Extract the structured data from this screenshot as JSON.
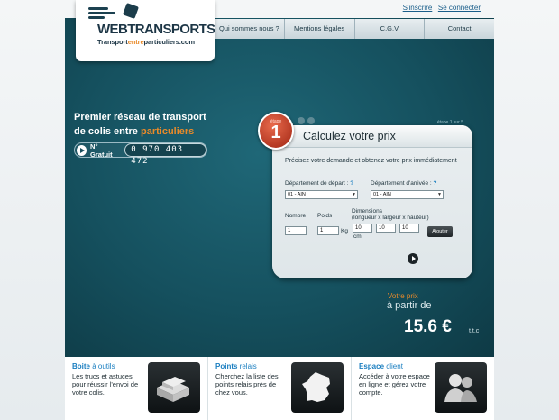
{
  "brand": {
    "logo_main": "WEBTRANSPORTS",
    "logo_sub_a": "Transport",
    "logo_sub_b": "entre",
    "logo_sub_c": "particuliers",
    "logo_sub_d": ".com"
  },
  "account_links": {
    "register": "S'inscrire",
    "separator": "|",
    "login": "Se connecter"
  },
  "nav": {
    "items": [
      "Qui sommes nous ?",
      "Mentions légales",
      "C.G.V",
      "Contact"
    ]
  },
  "hero": {
    "tagline_a": "Premier réseau de transport",
    "tagline_b": "de colis entre",
    "tagline_hl": "particuliers",
    "phone_label": "N° Gratuit",
    "phone_number": "0 970 403 472"
  },
  "step": {
    "word": "étape",
    "number": "1",
    "progress": "étape 1 sur 5"
  },
  "form": {
    "title": "Calculez votre prix",
    "description": "Précisez votre demande et obtenez votre prix immédiatement",
    "departure_label": "Département de départ :",
    "arrival_label": "Département d'arrivée :",
    "help_mark": "?",
    "departure_value": "01 - AIN",
    "arrival_value": "01 - AIN",
    "quantity_label": "Nombre",
    "weight_label": "Poids",
    "dimensions_label": "Dimensions",
    "dimensions_hint": "(longueur x largeur x hauteur)",
    "quantity_value": "1",
    "weight_value": "1",
    "weight_unit": "Kg",
    "length_value": "10",
    "width_value": "10",
    "height_value": "10",
    "length_unit": "cm",
    "add_button": "Ajouter"
  },
  "price": {
    "note": "Votre prix",
    "from": "à partir de",
    "value": "15.6 €",
    "unit": "t.t.c"
  },
  "features": [
    {
      "keyword": "Boite",
      "rest": " à outils",
      "text": "Les trucs et astuces pour réussir l'envoi de votre colis.",
      "icon": "parcels-icon"
    },
    {
      "keyword": "Points",
      "rest": " relais",
      "text": "Cherchez la liste des points relais près de chez vous.",
      "icon": "france-map-icon"
    },
    {
      "keyword": "Espace",
      "rest": " client",
      "text": "Accéder à votre espace en ligne et gérez votre compte.",
      "icon": "users-icon"
    }
  ],
  "colors": {
    "accent": "#e98a2a",
    "hero": "#15505e",
    "link": "#1a7ec0",
    "badge": "#c53a20"
  }
}
